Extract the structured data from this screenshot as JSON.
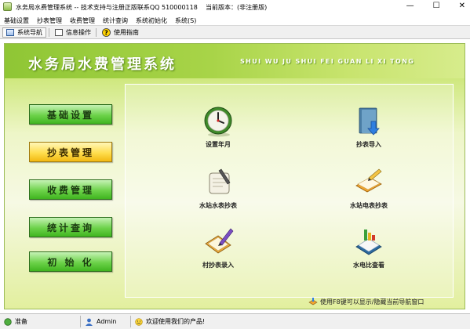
{
  "window": {
    "title": "水务局水费管理系统 -- 技术支持与注册正版联系QQ 510000118",
    "version_label": "当前版本：(非注册版)",
    "controls": {
      "minimize": "—",
      "maximize": "☐",
      "close": "✕"
    }
  },
  "menubar": {
    "items": [
      "基础设置",
      "抄表管理",
      "收费管理",
      "统计查询",
      "系统初始化",
      "系统(S)"
    ]
  },
  "toolbar": {
    "nav_label": "系统导航",
    "info_label": "信息操作",
    "help_label": "使用指南"
  },
  "header": {
    "title": "水务局水费管理系统",
    "pinyin": "SHUI WU JU SHUI FEI GUAN LI XI TONG"
  },
  "nav": {
    "items": [
      {
        "label": "基础设置",
        "style": "green"
      },
      {
        "label": "抄表管理",
        "style": "yellow",
        "selected": true
      },
      {
        "label": "收费管理",
        "style": "green"
      },
      {
        "label": "统计查询",
        "style": "green"
      },
      {
        "label": "初 始 化",
        "style": "green"
      }
    ]
  },
  "functions": [
    {
      "label": "设置年月",
      "icon": "clock-icon"
    },
    {
      "label": "抄表导入",
      "icon": "folder-import-icon"
    },
    {
      "label": "水站水表抄表",
      "icon": "scroll-pen-icon"
    },
    {
      "label": "水站电表抄表",
      "icon": "book-pen-icon"
    },
    {
      "label": "村抄表录入",
      "icon": "clipboard-pen-icon"
    },
    {
      "label": "水电比查看",
      "icon": "ledger-icon"
    }
  ],
  "hint": "使用F8键可以显示/隐藏当前导航窗口",
  "status": {
    "ready": "准备",
    "user": "Admin",
    "welcome": "欢迎使用我们的产品!"
  },
  "colors": {
    "accent_green": "#6dd24a",
    "selected_yellow": "#ffde4e",
    "panel_green": "#a7d24a"
  }
}
